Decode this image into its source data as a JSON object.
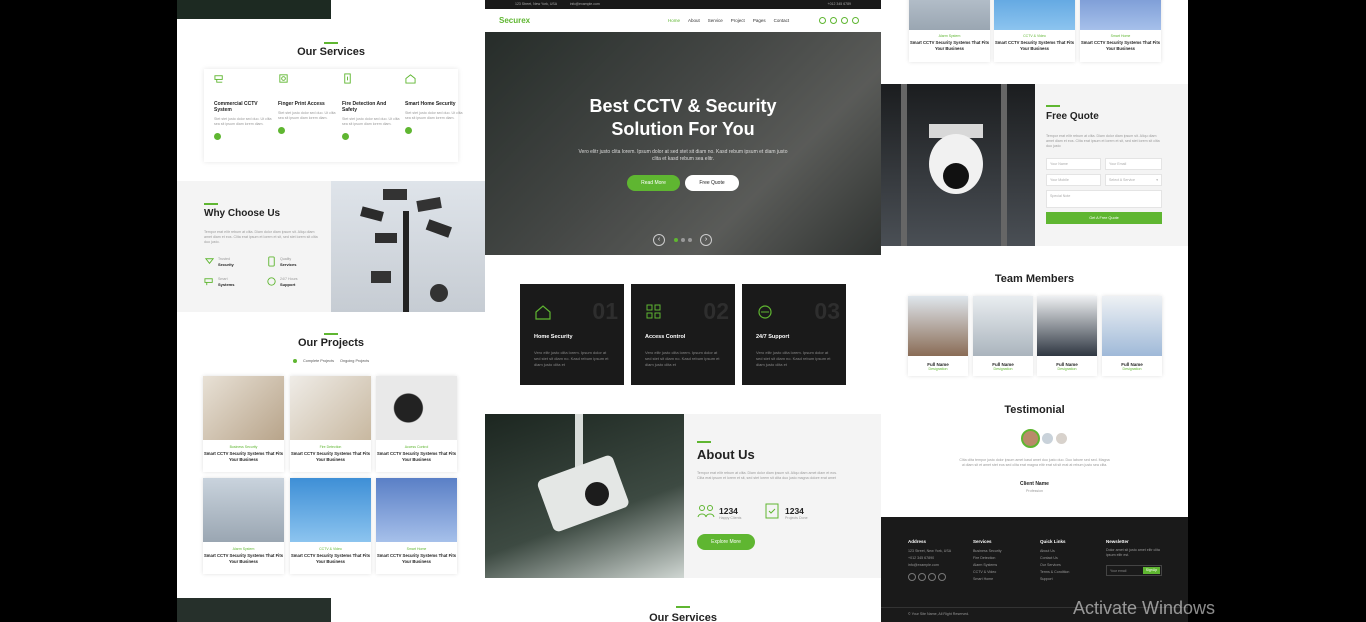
{
  "left": {
    "services_title": "Our Services",
    "services": [
      {
        "title": "Commercial CCTV System",
        "icon": "cctv-icon"
      },
      {
        "title": "Finger Print Access",
        "icon": "fingerprint-icon"
      },
      {
        "title": "Fire Detection And Safety",
        "icon": "fire-icon"
      },
      {
        "title": "Smart Home Security",
        "icon": "home-icon"
      }
    ],
    "service_desc": "Stet stet justo dolor sed duo. Ut clita sea sit ipsum diam lorem diam.",
    "why_title": "Why Choose Us",
    "why_desc": "Tempor erat elitr rebum at clita. Diam dolor diam ipsum sit. Aliqu diam amet diam et eos. Clita erat ipsum et lorem et sit, sed stet lorem sit clita duo justo.",
    "features": [
      {
        "line1": "Trusted",
        "line2": "Security"
      },
      {
        "line1": "Quality",
        "line2": "Services"
      },
      {
        "line1": "Smart",
        "line2": "Systems"
      },
      {
        "line1": "24/7 Hours",
        "line2": "Support"
      }
    ],
    "projects_title": "Our Projects",
    "filters": [
      "Complete Projects",
      "Ongoing Projects"
    ],
    "projects": [
      {
        "cat": "Business Security",
        "title": "Smart CCTV Security Systems That Fits Your Business"
      },
      {
        "cat": "Fire Detection",
        "title": "Smart CCTV Security Systems That Fits Your Business"
      },
      {
        "cat": "Access Control",
        "title": "Smart CCTV Security Systems That Fits Your Business"
      },
      {
        "cat": "Alarm System",
        "title": "Smart CCTV Security Systems That Fits Your Business"
      },
      {
        "cat": "CCTV & Video",
        "title": "Smart CCTV Security Systems That Fits Your Business"
      },
      {
        "cat": "Smart Home",
        "title": "Smart CCTV Security Systems That Fits Your Business"
      }
    ]
  },
  "mid": {
    "topbar": [
      "123 Street, New York, USA",
      "info@example.com",
      "+012 345 6789"
    ],
    "brand": "Securex",
    "nav": [
      "Home",
      "About",
      "Service",
      "Project",
      "Pages",
      "Contact"
    ],
    "hero_title_1": "Best CCTV & Security",
    "hero_title_2": "Solution For You",
    "hero_desc": "Vero elitr justo clita lorem. Ipsum dolor at sed stet sit diam no. Kasd rebum ipsum et diam justo clita et kasd rebum sea elitr.",
    "btn_read": "Read More",
    "btn_quote": "Free Quote",
    "cards": [
      {
        "num": "01",
        "title": "Home Security",
        "desc": "Vero elitr justo clita lorem. Ipsum dolor at sed stet sit diam no. Kasd rebum ipsum et diam justo clita et",
        "icon": "home-security-icon"
      },
      {
        "num": "02",
        "title": "Access Control",
        "desc": "Vero elitr justo clita lorem. Ipsum dolor at sed stet sit diam no. Kasd rebum ipsum et diam justo clita et",
        "icon": "keypad-icon"
      },
      {
        "num": "03",
        "title": "24/7 Support",
        "desc": "Vero elitr justo clita lorem. Ipsum dolor at sed stet sit diam no. Kasd rebum ipsum et diam justo clita et",
        "icon": "headset-icon"
      }
    ],
    "about_title": "About Us",
    "about_desc": "Tempor erat elitr rebum at clita. Diam dolor diam ipsum sit. Aliqu diam amet diam et eos. Clita erat ipsum et lorem et sit, sed stet lorem sit clita duo justo magna dolore erat amet",
    "stats": [
      {
        "num": "1234",
        "label": "Happy Clients",
        "icon": "users-icon"
      },
      {
        "num": "1234",
        "label": "Projects Done",
        "icon": "check-doc-icon"
      }
    ],
    "btn_explore": "Explore More",
    "services_title": "Our Services"
  },
  "right": {
    "projects_top": [
      {
        "cat": "Alarm System",
        "title": "Smart CCTV Security Systems That Fits Your Business"
      },
      {
        "cat": "CCTV & Video",
        "title": "Smart CCTV Security Systems That Fits Your Business"
      },
      {
        "cat": "Smart Home",
        "title": "Smart CCTV Security Systems That Fits Your Business"
      }
    ],
    "quote_title": "Free Quote",
    "quote_desc": "Tempor erat elitr rebum at clita. Diam dolor diam ipsum sit. Aliqu diam amet diam et eos. Clita erat ipsum et lorem et sit, sed stet lorem sit clita duo justo",
    "fields": {
      "name": "Your Name",
      "email": "Your Email",
      "mobile": "Your Mobile",
      "service": "Select A Service",
      "note": "Special Note"
    },
    "quote_btn": "Get A Free Quote",
    "team_title": "Team Members",
    "team": [
      {
        "name": "Full Name",
        "role": "Designation"
      },
      {
        "name": "Full Name",
        "role": "Designation"
      },
      {
        "name": "Full Name",
        "role": "Designation"
      },
      {
        "name": "Full Name",
        "role": "Designation"
      }
    ],
    "testimonial_title": "Testimonial",
    "testimonial_text": "Clita clita tempor justo dolor ipsum amet kasd amet duo justo duo. Duo labore sed sed. Magna ut diam sit et amet stet eos sed clita erat magna elitr erat sit sit erat at rebum justo sea clita.",
    "client_name": "Client Name",
    "client_role": "Profession",
    "footer": {
      "address_h": "Address",
      "address": [
        "123 Street, New York, USA",
        "+012 345 67890",
        "info@example.com"
      ],
      "services_h": "Services",
      "services": [
        "Business Security",
        "Fire Detection",
        "Alarm Systems",
        "CCTV & Video",
        "Smart Home"
      ],
      "links_h": "Quick Links",
      "links": [
        "About Us",
        "Contact Us",
        "Our Services",
        "Terms & Condition",
        "Support"
      ],
      "news_h": "Newsletter",
      "news_desc": "Dolor amet sit justo amet elitr clita ipsum elitr est.",
      "email_ph": "Your email",
      "signup": "SignUp",
      "copyright": "© Your Site Name, All Right Reserved."
    }
  },
  "watermark": "Activate Windows"
}
